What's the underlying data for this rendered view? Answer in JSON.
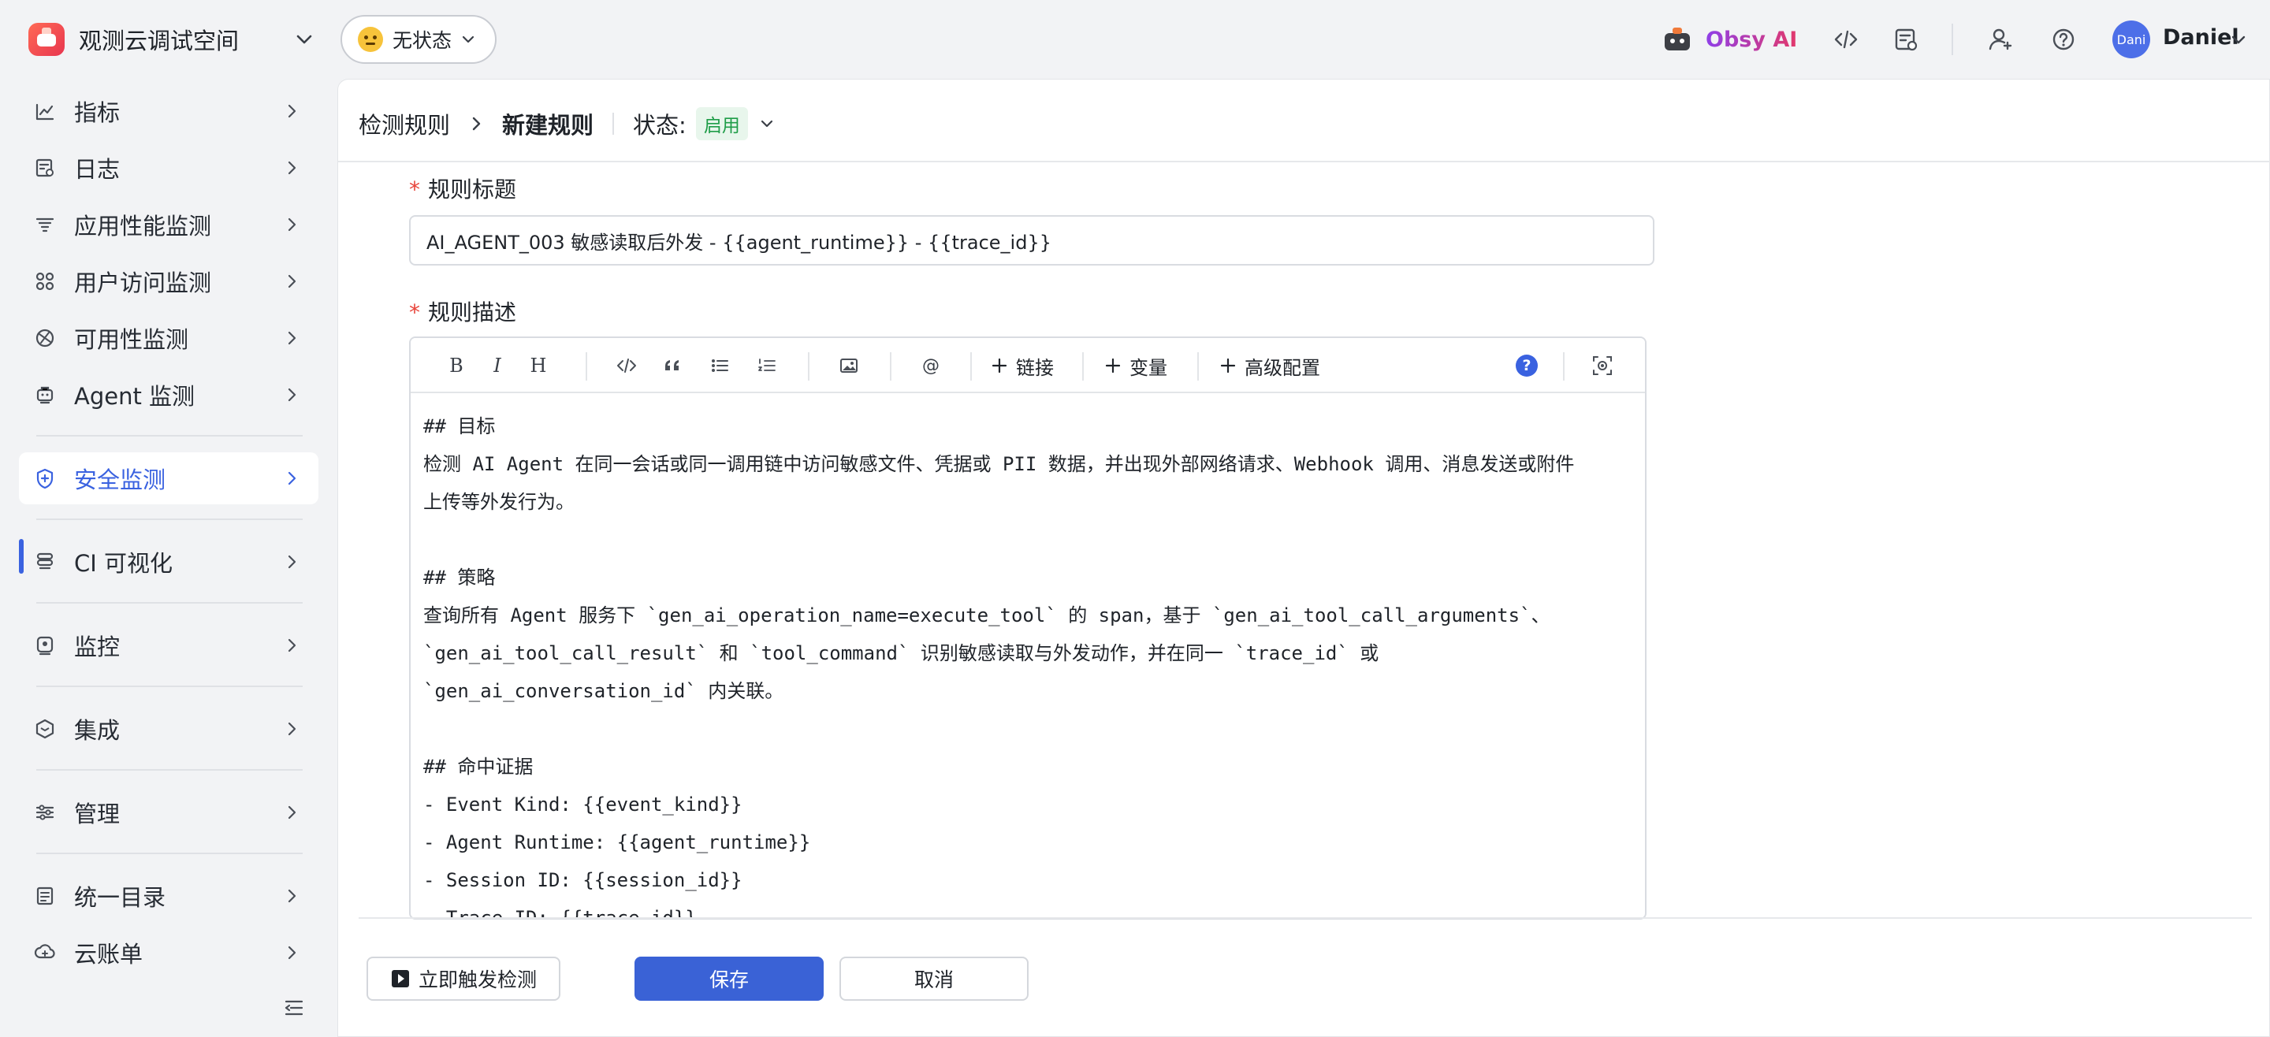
{
  "topbar": {
    "workspace_name": "观测云调试空间",
    "status_label": "无状态",
    "assistant_label": "Obsy AI",
    "avatar_text": "Dani",
    "user_name": "Daniel"
  },
  "sidebar": {
    "items": [
      {
        "label": "指标",
        "icon": "metrics-icon"
      },
      {
        "label": "日志",
        "icon": "log-icon"
      },
      {
        "label": "应用性能监测",
        "icon": "apm-icon"
      },
      {
        "label": "用户访问监测",
        "icon": "rum-icon"
      },
      {
        "label": "可用性监测",
        "icon": "availability-icon"
      },
      {
        "label": "Agent 监测",
        "icon": "agent-icon"
      },
      {
        "label": "安全监测",
        "icon": "security-shield-icon",
        "active": true
      },
      {
        "label": "CI 可视化",
        "icon": "ci-icon"
      },
      {
        "label": "监控",
        "icon": "monitor-icon"
      },
      {
        "label": "集成",
        "icon": "integration-icon"
      },
      {
        "label": "管理",
        "icon": "settings-sliders-icon"
      },
      {
        "label": "统一目录",
        "icon": "catalog-icon"
      },
      {
        "label": "云账单",
        "icon": "cloud-bill-icon"
      }
    ]
  },
  "header": {
    "breadcrumb_parent": "检测规则",
    "breadcrumb_current": "新建规则",
    "state_label": "状态:",
    "state_value": "启用"
  },
  "form": {
    "title_label": "规则标题",
    "title_value": "AI_AGENT_003 敏感读取后外发 - {{agent_runtime}} - {{trace_id}}",
    "desc_label": "规则描述",
    "toolbar": {
      "bold": "B",
      "italic": "I",
      "heading": "H",
      "mention": "@",
      "link": "链接",
      "variable": "变量",
      "advanced": "高级配置",
      "help": "?"
    },
    "description": "## 目标\n检测 AI Agent 在同一会话或同一调用链中访问敏感文件、凭据或 PII 数据，并出现外部网络请求、Webhook 调用、消息发送或附件\n上传等外发行为。\n\n## 策略\n查询所有 Agent 服务下 `gen_ai_operation_name=execute_tool` 的 span，基于 `gen_ai_tool_call_arguments`、\n`gen_ai_tool_call_result` 和 `tool_command` 识别敏感读取与外发动作，并在同一 `trace_id` 或\n`gen_ai_conversation_id` 内关联。\n\n## 命中证据\n- Event Kind: {{event_kind}}\n- Agent Runtime: {{agent_runtime}}\n- Session ID: {{session_id}}\n- Trace ID: {{trace_id}}"
  },
  "footer": {
    "trigger_label": "立即触发检测",
    "save_label": "保存",
    "cancel_label": "取消"
  },
  "colors": {
    "accent": "#3a62e0",
    "save_button": "#3a62d6",
    "enabled_badge_text": "#1f9d48",
    "required_mark": "#e8443a"
  }
}
